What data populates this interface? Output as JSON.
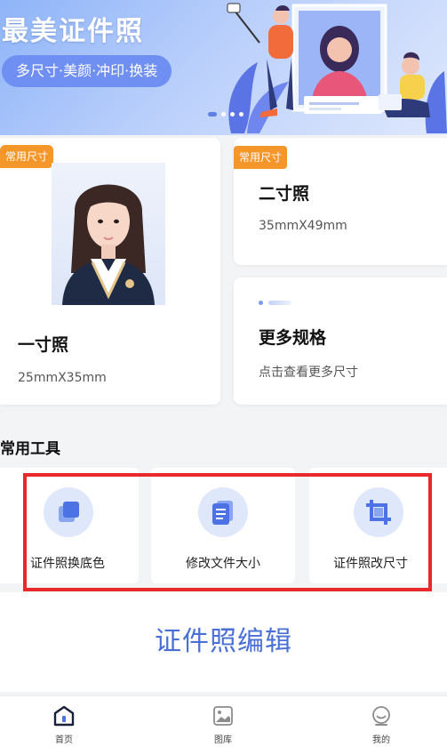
{
  "banner": {
    "title": "最美证件照",
    "tagline": "多尺寸·美颜·冲印·换装"
  },
  "cards": {
    "one_inch": {
      "badge": "常用尺寸",
      "title": "一寸照",
      "size": "25mmX35mm"
    },
    "two_inch": {
      "badge": "常用尺寸",
      "title": "二寸照",
      "size": "35mmX49mm"
    },
    "more": {
      "title": "更多规格",
      "subtitle": "点击查看更多尺寸"
    }
  },
  "tools": {
    "section_title": "常用工具",
    "items": [
      {
        "label": "证件照换底色",
        "icon": "layers-icon"
      },
      {
        "label": "修改文件大小",
        "icon": "document-icon"
      },
      {
        "label": "证件照改尺寸",
        "icon": "crop-icon"
      }
    ]
  },
  "edit": {
    "label": "证件照编辑"
  },
  "nav": {
    "items": [
      {
        "label": "首页",
        "icon": "home-icon"
      },
      {
        "label": "图库",
        "icon": "gallery-icon"
      },
      {
        "label": "我的",
        "icon": "profile-icon"
      }
    ]
  },
  "colors": {
    "accent": "#4a6fd6",
    "badge": "#f5962b",
    "highlight_border": "#e8282b",
    "banner_pill": "#6f8ff2"
  }
}
